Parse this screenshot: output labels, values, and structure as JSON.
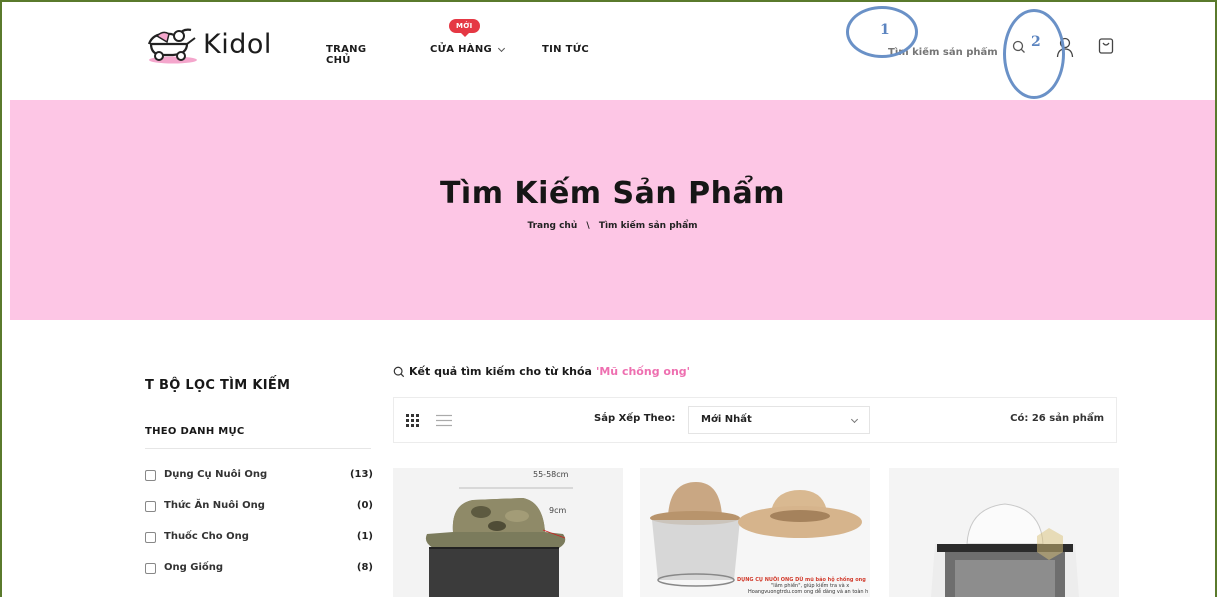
{
  "header": {
    "logo_text": "Kidol",
    "nav": [
      {
        "label": "TRANG CHỦ"
      },
      {
        "label": "CỬA HÀNG",
        "badge": "MỚI"
      },
      {
        "label": "TIN TỨC"
      }
    ],
    "search_placeholder": "Tìm kiếm sản phẩm",
    "markers": [
      "1",
      "2"
    ]
  },
  "banner": {
    "title": "Tìm Kiếm Sản Phẩm",
    "breadcrumb": [
      "Trang chủ",
      "\\",
      "Tìm kiếm sản phẩm"
    ]
  },
  "sidebar": {
    "filter_title": "T BỘ LỌC TÌM KIẾM",
    "category_title": "THEO DANH MỤC",
    "categories": [
      {
        "label": "Dụng Cụ Nuôi Ong",
        "count": "(13)"
      },
      {
        "label": "Thức Ăn Nuôi Ong",
        "count": "(0)"
      },
      {
        "label": "Thuốc Cho Ong",
        "count": "(1)"
      },
      {
        "label": "Ong Giống",
        "count": "(8)"
      }
    ]
  },
  "results": {
    "prefix": "Kết quả tìm kiếm cho từ khóa",
    "keyword": "'Mũ chống ong'",
    "sort_label": "Sắp Xếp Theo:",
    "sort_value": "Mới Nhất",
    "count_text": "Có: 26 sản phẩm"
  },
  "products": [
    {
      "dims": [
        "55-58cm",
        "9cm"
      ]
    },
    {
      "texts": [
        "DỤNG CỤ NUÔI ONG DÙ mũ bảo hộ chống ong",
        "\"lâm phiền\", giúp kiểm tra và x",
        "Hoangvuongtrdu.com ong dễ dàng và an toàn h"
      ]
    },
    {}
  ],
  "colors": {
    "banner_bg": "#fdc6e5",
    "keyword": "#ee6fb0",
    "badge": "#e53844",
    "marker": "#6a91c7"
  }
}
